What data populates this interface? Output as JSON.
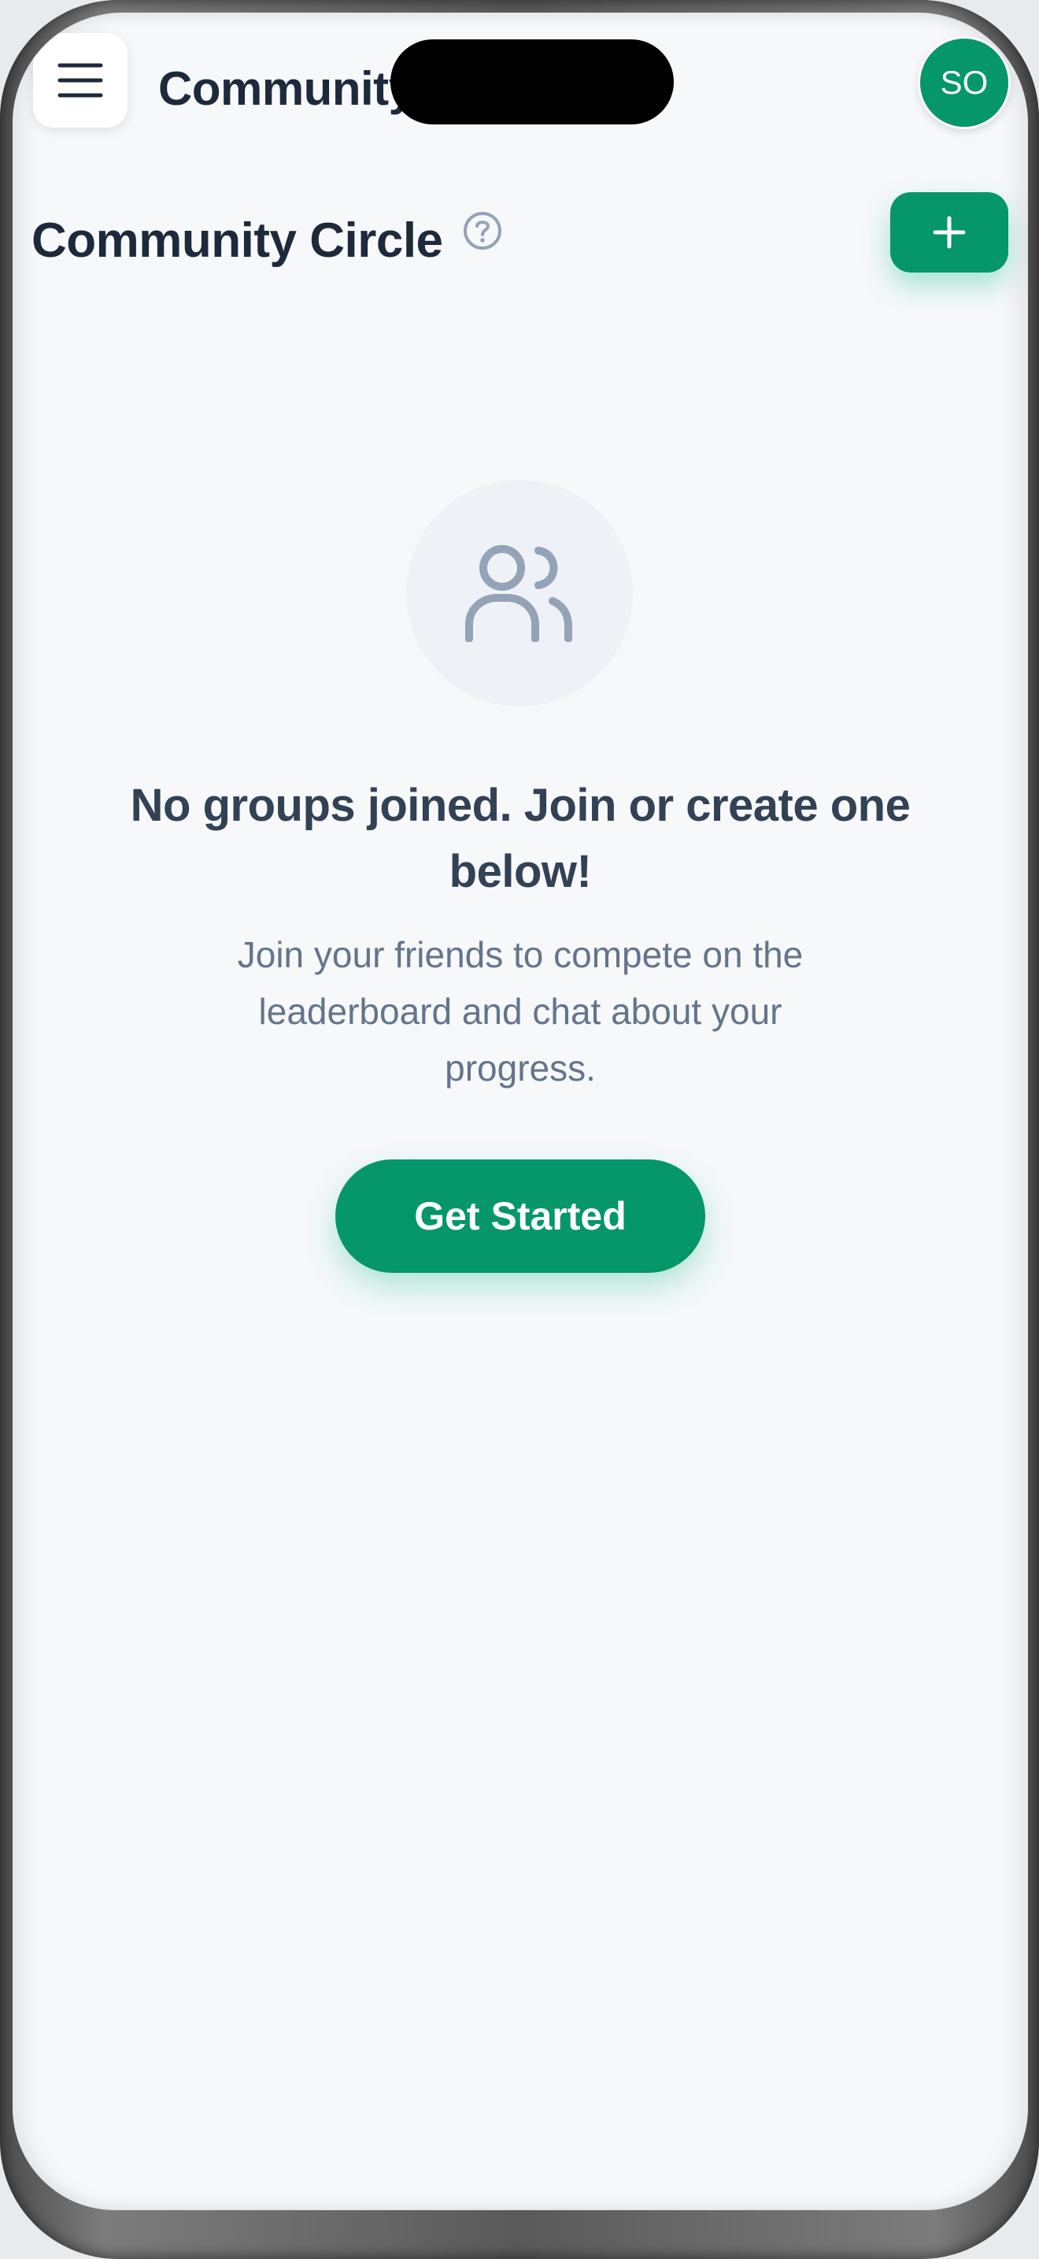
{
  "header": {
    "title": "Community Circle",
    "menu_icon": "hamburger-menu-icon",
    "avatar_initials": "SO"
  },
  "section": {
    "title": "Community Circle",
    "help_icon": "question-circle-icon",
    "add_icon": "plus-icon"
  },
  "empty_state": {
    "icon": "users-icon",
    "title": "No groups joined. Join or create one below!",
    "description": "Join your friends to compete on the leaderboard and chat about your progress.",
    "cta_label": "Get Started"
  },
  "colors": {
    "accent": "#059669",
    "background": "#f6f8fa",
    "heading": "#1e293b",
    "muted_text": "#64748b",
    "icon_gray": "#94a3b8"
  }
}
